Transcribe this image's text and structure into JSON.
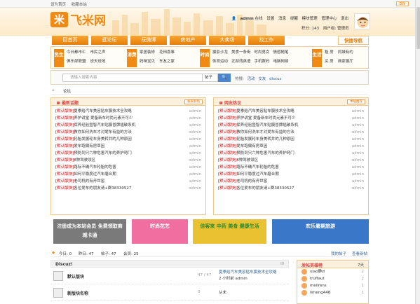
{
  "topbar": {
    "set_home": "设为首页",
    "bookmark": "收藏本站",
    "diy": "DIY"
  },
  "logo": {
    "mark": "米",
    "name": "飞米网"
  },
  "user": {
    "name": "admin",
    "status": "在线",
    "links": [
      "设置",
      "消息",
      "提醒",
      "模块管理",
      "管理中心",
      "退出"
    ],
    "points": "积分: 143",
    "group": "用户组: 管理员"
  },
  "nav": {
    "items": [
      "回首页",
      "逛论坛",
      "玩微博",
      "房地产",
      "大卖场",
      "找工作"
    ],
    "quick": "快捷导航"
  },
  "cats": [
    {
      "tag": "民生",
      "color": "#f08a14",
      "links": [
        "今日都市汇",
        "市民之声",
        "俱乐部联盟",
        "说天说地"
      ]
    },
    {
      "tag": "消费",
      "color": "#f08a14",
      "links": [
        "家居装修",
        "花田喜事",
        "妈咪宝贝",
        "车友之家"
      ]
    },
    {
      "tag": "时尚",
      "color": "#f08a14",
      "links": [
        "摄影沙龙",
        "美食一条街",
        "时尚男女",
        "情感随笔",
        "体育运动",
        "北部湾英语",
        "手机数码",
        "电脑网络"
      ]
    },
    {
      "tag": "生活",
      "color": "#f08a14",
      "links": [
        "租 房",
        "同城有约",
        "买 房",
        "商家展厅"
      ]
    }
  ],
  "search": {
    "placeholder": "请输入搜索内容",
    "type": "帖子",
    "button": "🔍",
    "hot_label": "热搜:",
    "hot_words": [
      "活动",
      "交友",
      "discuz"
    ]
  },
  "breadcrumb": {
    "home_icon": "⌂",
    "item": "论坛"
  },
  "panel_left": {
    "title": "最新话题",
    "button": "发表新帖"
  },
  "panel_right": {
    "title": "网友热议",
    "button": "本站推荐"
  },
  "threads": [
    {
      "tag": "[默认版块]",
      "title": "夏季给汽车美容贴车膜技术全攻略",
      "author": "admin"
    },
    {
      "tag": "[默认版块]",
      "title": "养护讲堂 爱备新车时尚元素不可少",
      "author": "admin"
    },
    {
      "tag": "[默认版块]",
      "title": "保养经验暨智汽车贴膜冒牌插破系机",
      "author": "admin"
    },
    {
      "tag": "[默认版块]",
      "title": "教你如何洗车才对爱车有益的方法",
      "author": "admin"
    },
    {
      "tag": "[默认版块]",
      "title": "轮胎发展轮车身美转并的几种原因",
      "author": "admin"
    },
    {
      "tag": "[默认版块]",
      "title": "爱车跑偏有房草因",
      "author": "admin"
    },
    {
      "tag": "[默认版块]",
      "title": "预防到只六种危害汽车的养护窍门",
      "author": "admin"
    },
    {
      "tag": "[默认版块]",
      "title": "8种驾驶误区",
      "author": "admin"
    },
    {
      "tag": "[默认版块]",
      "title": "路际不确汽车轮胎的危害",
      "author": "admin"
    },
    {
      "tag": "[默认版块]",
      "title": "如何平稳度过汽车磨合期",
      "author": "admin"
    },
    {
      "tag": "[默认版块]",
      "title": "老司机的有舟世窖",
      "author": "admin"
    },
    {
      "tag": "[默认版块]",
      "title": "各位爱车的朋友请+群38330527",
      "author": "admin"
    }
  ],
  "ads": [
    {
      "text": "注册成为本站会员 免费领取商城卡通",
      "bg": "#7a7a7a",
      "fg": "#ffffff"
    },
    {
      "text": "时尚花艺",
      "bg": "#f06fa0",
      "fg": "#ffffff"
    },
    {
      "text": "佳客来 中药 美食 健康生活",
      "bg": "#e9c232",
      "fg": "#2f8a2f"
    },
    {
      "text": "欢乐暑期旅游",
      "bg": "#3a77c9",
      "fg": "#ffffff"
    }
  ],
  "stats": {
    "today": "今日: 0",
    "yesterday": "昨日: 47",
    "posts": "帖子: 47",
    "members": "会员: 25",
    "my_posts": "我的帖子",
    "view_new": "查看新帖"
  },
  "forum_header": "Discuz!",
  "forums": [
    {
      "name": "默认版块",
      "count": "47 / 47",
      "last_title": "夏季给汽车美容贴车膜技术全攻略",
      "last_time": "2 小时前 admin"
    },
    {
      "name": "新版块名称",
      "count": "0",
      "last_title": "从未",
      "last_time": ""
    }
  ],
  "side": {
    "title": "发帖英雄榜",
    "range": "7天",
    "users": [
      {
        "name": "xiao静zi",
        "value": "2"
      },
      {
        "name": "truffaut",
        "value": "2"
      },
      {
        "name": "meilrens",
        "value": "1"
      },
      {
        "name": "limeng448",
        "value": "1"
      }
    ]
  }
}
